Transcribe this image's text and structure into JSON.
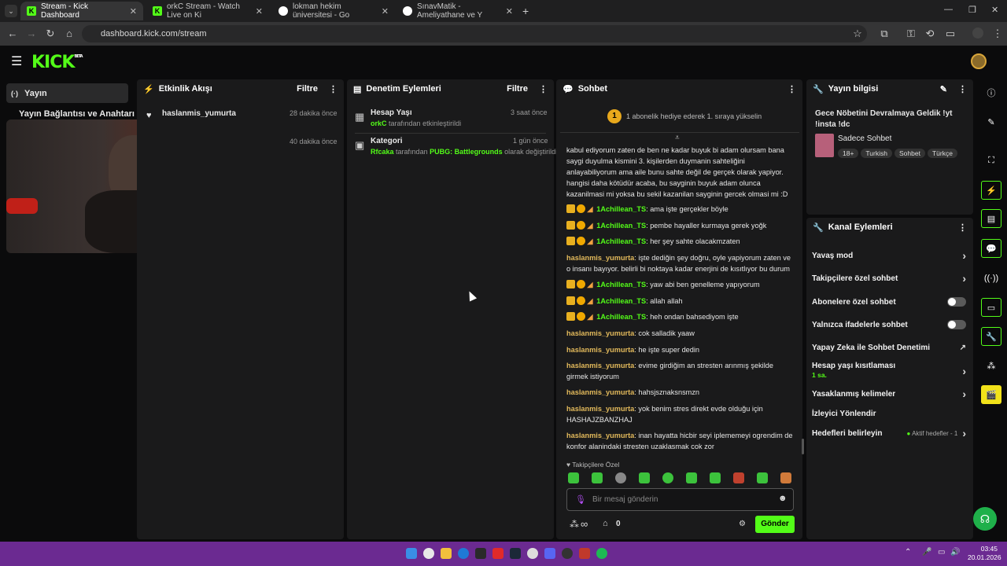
{
  "browser": {
    "tabs": [
      {
        "title": "Stream - Kick Dashboard",
        "active": true
      },
      {
        "title": "orkC Stream - Watch Live on Ki",
        "active": false
      },
      {
        "title": "lokman hekim üniversitesi - Go",
        "active": false
      },
      {
        "title": "SınavMatik - Ameliyathane ve Y",
        "active": false
      }
    ],
    "url": "dashboard.kick.com/stream"
  },
  "sidebar": {
    "active_item": "Yayın",
    "item2": "Yayın Bağlantısı ve Anahtarı"
  },
  "activity": {
    "title": "Etkinlik Akışı",
    "filter": "Filtre",
    "events": [
      {
        "user": "haslanmis_yumurta",
        "time": "28 dakika önce"
      },
      {
        "user": "",
        "time": "40 dakika önce"
      }
    ]
  },
  "moderation": {
    "title": "Denetim Eylemleri",
    "filter": "Filtre",
    "actions": [
      {
        "title": "Hesap Yaşı",
        "actor": "orkC",
        "text": "tarafından etkinleştirildi",
        "time": "3 saat önce"
      },
      {
        "title": "Kategori",
        "actor": "Rfcaka",
        "text_pre": "tarafından",
        "value": "PUBG: Battlegrounds",
        "text_post": "olarak değiştirildi",
        "time": "1 gün önce"
      }
    ]
  },
  "chat": {
    "title": "Sohbet",
    "banner": "1 abonelik hediye ederek 1. sıraya yükselin",
    "banner_num": "1",
    "messages": [
      {
        "user": "",
        "text": "kabul ediyorum zaten de ben ne kadar buyuk bi adam olursam bana saygi duyulma kismini 3. kişilerden duymanin sahteliğini anlayabiliyorum ama aile bunu sahte değil de gerçek olarak yapiyor. hangisi daha kötüdür acaba, bu sayginin buyuk adam olunca kazanilmasi mi yoksa bu sekil kazanilan sayginin gercek olmasi mi :D"
      },
      {
        "user": "1Achillean_TS",
        "text": "ama işte gerçekler böyle",
        "badges": true
      },
      {
        "user": "1Achillean_TS",
        "text": "pembe hayaller kurmaya gerek yoğk",
        "badges": true
      },
      {
        "user": "1Achillean_TS",
        "text": "her şey sahte olacakmzaten",
        "badges": true
      },
      {
        "user": "haslanmis_yumurta",
        "text": "işte dediğin şey doğru, oyle yapiyorum zaten ve o insanı bayıyor. belirli bi noktaya kadar enerjini de kısıtlıyor bu durum"
      },
      {
        "user": "1Achillean_TS",
        "text": "yaw abi ben genelleme yapıyorum",
        "badges": true
      },
      {
        "user": "1Achillean_TS",
        "text": "allah allah",
        "badges": true
      },
      {
        "user": "1Achillean_TS",
        "text": "heh ondan bahsediyom işte",
        "badges": true
      },
      {
        "user": "haslanmis_yumurta",
        "text": "cok salladik yaaw"
      },
      {
        "user": "haslanmis_yumurta",
        "text": "he işte super dedin"
      },
      {
        "user": "haslanmis_yumurta",
        "text": "evime girdiğim an stresten arınmış şekilde girmek istiyorum"
      },
      {
        "user": "haslanmis_yumurta",
        "text": "hahsjsznaksnsmzn"
      },
      {
        "user": "haslanmis_yumurta",
        "text": "yok benim stres direkt evde olduğu için HASHAJZBANZHAJ"
      },
      {
        "user": "haslanmis_yumurta",
        "text": "inan hayatta hicbir seyi iplememeyi ogrendim de konfor alanindaki stresten uzaklasmak cok zor"
      }
    ],
    "followers_only": "Takipçilere Özel",
    "input_placeholder": "Bir mesaj gönderin",
    "infinity": "∞",
    "count": "0",
    "send": "Gönder"
  },
  "stream_info": {
    "title": "Yayın bilgisi",
    "stream_title": "Gece Nöbetini Devralmaya Geldik !yt !insta !dc",
    "category": "Sadece Sohbet",
    "tags": [
      "18+",
      "Turkish",
      "Sohbet",
      "Türkçe"
    ]
  },
  "channel_actions": {
    "title": "Kanal Eylemleri",
    "items": [
      {
        "label": "Yavaş mod"
      },
      {
        "label": "Takipçilere özel sohbet"
      },
      {
        "label": "Abonelere özel sohbet"
      },
      {
        "label": "Yalnızca ifadelerle sohbet"
      },
      {
        "label": "Yapay Zeka ile Sohbet Denetimi"
      },
      {
        "label": "Hesap yaşı kısıtlaması",
        "sub": "1 sa."
      },
      {
        "label": "Yasaklanmış kelimeler"
      },
      {
        "label": "İzleyici Yönlendir"
      },
      {
        "label": "Hedefleri belirleyin",
        "extra": "Aktif hedefler - 1"
      }
    ]
  },
  "clock": {
    "time": "03:45",
    "date": "20.01.2026"
  },
  "colors": {
    "brand": "#53fc18",
    "taskbar": "#6b2a91",
    "panel": "#1a1a1b"
  }
}
